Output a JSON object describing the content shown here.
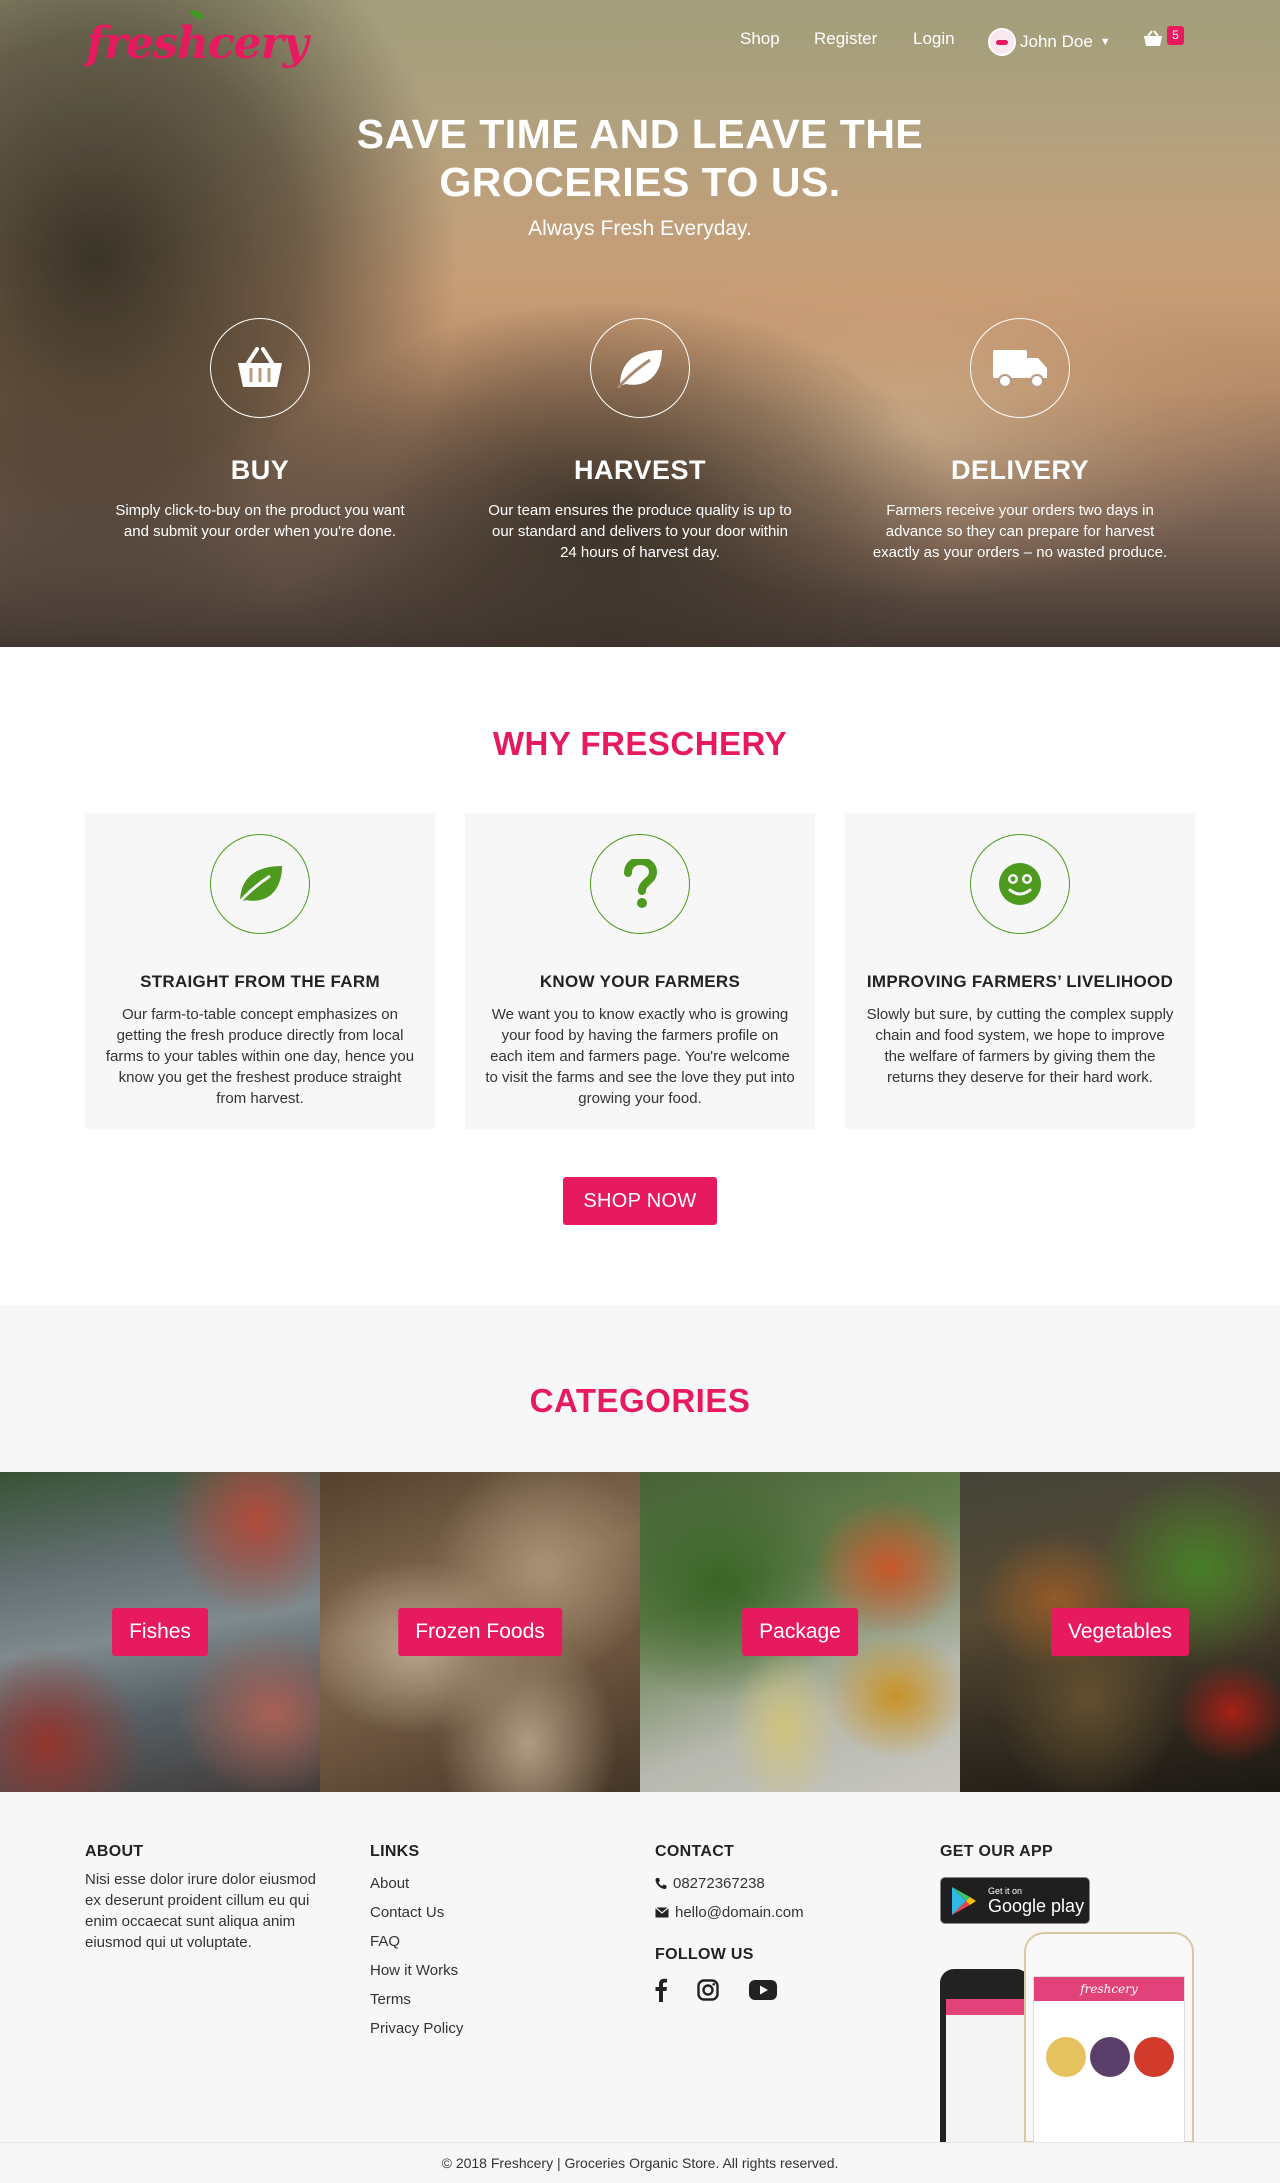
{
  "brand": {
    "logo_text": "freshcery",
    "accent": "#e7195f",
    "green": "#4e9a1e"
  },
  "nav": {
    "items": [
      {
        "label": "Shop"
      },
      {
        "label": "Register"
      },
      {
        "label": "Login"
      }
    ],
    "user": {
      "name": "John Doe",
      "icon": "chevron-down-icon"
    },
    "cart": {
      "icon": "basket-icon",
      "count": "5"
    }
  },
  "hero": {
    "title_line1": "SAVE TIME AND LEAVE THE",
    "title_line2": "GROCERIES TO US.",
    "subtitle": "Always Fresh Everyday.",
    "features": [
      {
        "icon": "basket-icon",
        "title": "BUY",
        "text": "Simply click-to-buy on the product you want and submit your order when you're done."
      },
      {
        "icon": "leaf-icon",
        "title": "HARVEST",
        "text": "Our team ensures the produce quality is up to our standard and delivers to your door within 24 hours of harvest day."
      },
      {
        "icon": "truck-icon",
        "title": "DELIVERY",
        "text": "Farmers receive your orders two days in advance so they can prepare for harvest exactly as your orders – no wasted produce."
      }
    ]
  },
  "why": {
    "title": "WHY FRESCHERY",
    "cards": [
      {
        "icon": "leaf-icon",
        "title": "STRAIGHT FROM THE FARM",
        "text": "Our farm-to-table concept emphasizes on getting the fresh produce directly from local farms to your tables within one day, hence you know you get the freshest produce straight from harvest."
      },
      {
        "icon": "question-icon",
        "title": "KNOW YOUR FARMERS",
        "text": "We want you to know exactly who is growing your food by having the farmers profile on each item and farmers page. You're welcome to visit the farms and see the love they put into growing your food."
      },
      {
        "icon": "smile-icon",
        "title": "IMPROVING FARMERS’ LIVELIHOOD",
        "text": "Slowly but sure, by cutting the complex supply chain and food system, we hope to improve the welfare of farmers by giving them the returns they deserve for their hard work."
      }
    ],
    "cta": "SHOP NOW"
  },
  "categories": {
    "title": "CATEGORIES",
    "items": [
      {
        "label": "Fishes"
      },
      {
        "label": "Frozen Foods"
      },
      {
        "label": "Package"
      },
      {
        "label": "Vegetables"
      }
    ]
  },
  "footer": {
    "about": {
      "title": "ABOUT",
      "text": "Nisi esse dolor irure dolor eiusmod ex deserunt proident cillum eu qui enim occaecat sunt aliqua anim eiusmod qui ut voluptate."
    },
    "links": {
      "title": "LINKS",
      "items": [
        "About",
        "Contact Us",
        "FAQ",
        "How it Works",
        "Terms",
        "Privacy Policy"
      ]
    },
    "contact": {
      "title": "CONTACT",
      "phone": "08272367238",
      "email": "hello@domain.com"
    },
    "follow": {
      "title": "FOLLOW US",
      "icons": [
        "facebook-icon",
        "instagram-icon",
        "youtube-icon"
      ]
    },
    "app": {
      "title": "GET OUR APP",
      "badge_small": "Get it on",
      "badge_big": "Google play"
    },
    "copyright": "© 2018 Freshcery | Groceries Organic Store. All rights reserved."
  }
}
